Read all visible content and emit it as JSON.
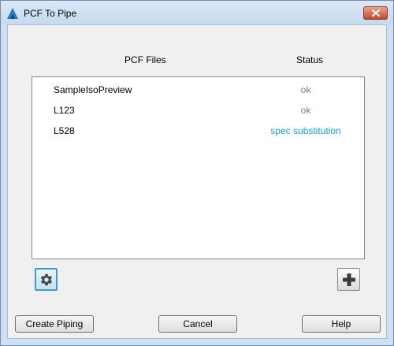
{
  "window": {
    "title": "PCF To Pipe"
  },
  "table": {
    "headers": {
      "files": "PCF Files",
      "status": "Status"
    },
    "rows": [
      {
        "name": "SampleIsoPreview",
        "status": "ok",
        "status_kind": "ok"
      },
      {
        "name": "L123",
        "status": "ok",
        "status_kind": "ok"
      },
      {
        "name": "L528",
        "status": "spec substitution",
        "status_kind": "warning"
      }
    ]
  },
  "icons": {
    "settings": "gear-icon",
    "add": "plus-icon",
    "app": "autodesk-logo-icon",
    "close": "close-icon"
  },
  "buttons": {
    "create": "Create Piping",
    "cancel": "Cancel",
    "help": "Help"
  },
  "colors": {
    "ok_status": "#7a7a7a",
    "warning_status": "#1a9ad6"
  }
}
